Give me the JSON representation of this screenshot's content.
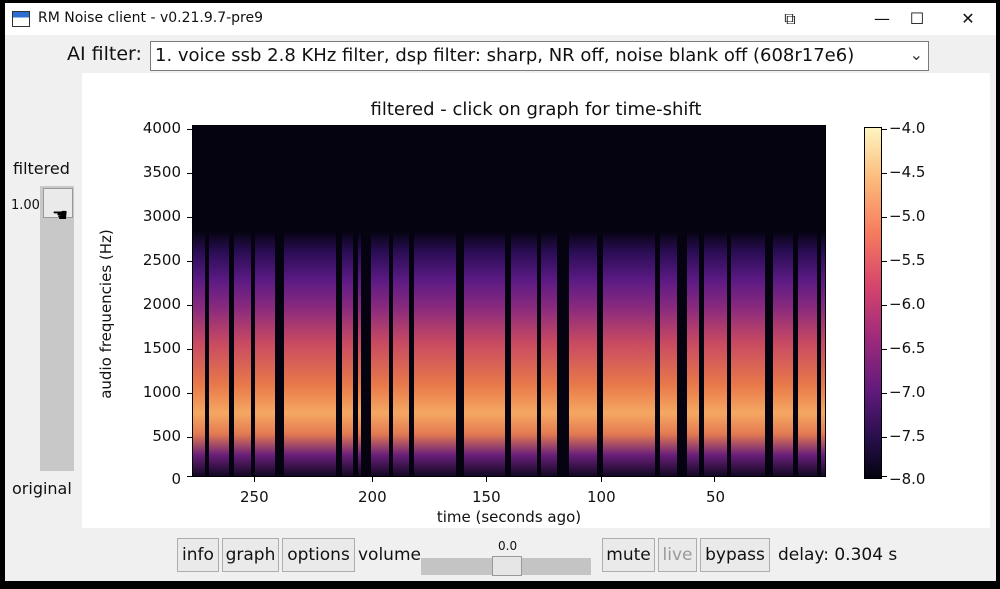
{
  "window": {
    "title": "RM Noise client - v0.21.9.7-pre9",
    "controls": [
      "⧉",
      "—",
      "☐",
      "✕"
    ]
  },
  "filter": {
    "label": "AI filter:",
    "value": "1. voice ssb 2.8 KHz filter, dsp filter: sharp, NR off, noise blank off (608r17e6)"
  },
  "side": {
    "top_label": "filtered",
    "bottom_label": "original",
    "slider_value": "1.00"
  },
  "graph": {
    "title": "filtered - click on graph for time-shift",
    "ylabel": "audio frequencies (Hz)",
    "xlabel": "time (seconds ago)",
    "yticks": [
      "4000",
      "3500",
      "3000",
      "2500",
      "2000",
      "1500",
      "1000",
      "500",
      "0"
    ],
    "xticks": [
      "250",
      "200",
      "150",
      "100",
      "50"
    ],
    "cbar_ticks": [
      "−4.0",
      "−4.5",
      "−5.0",
      "−5.5",
      "−6.0",
      "−6.5",
      "−7.0",
      "−7.5",
      "−8.0"
    ]
  },
  "controls": {
    "info": "info",
    "graph": "graph",
    "options": "options",
    "volume_label": "volume",
    "volume_value": "0.0",
    "mute": "mute",
    "live": "live",
    "bypass": "bypass",
    "delay": "delay: 0.304 s"
  }
}
